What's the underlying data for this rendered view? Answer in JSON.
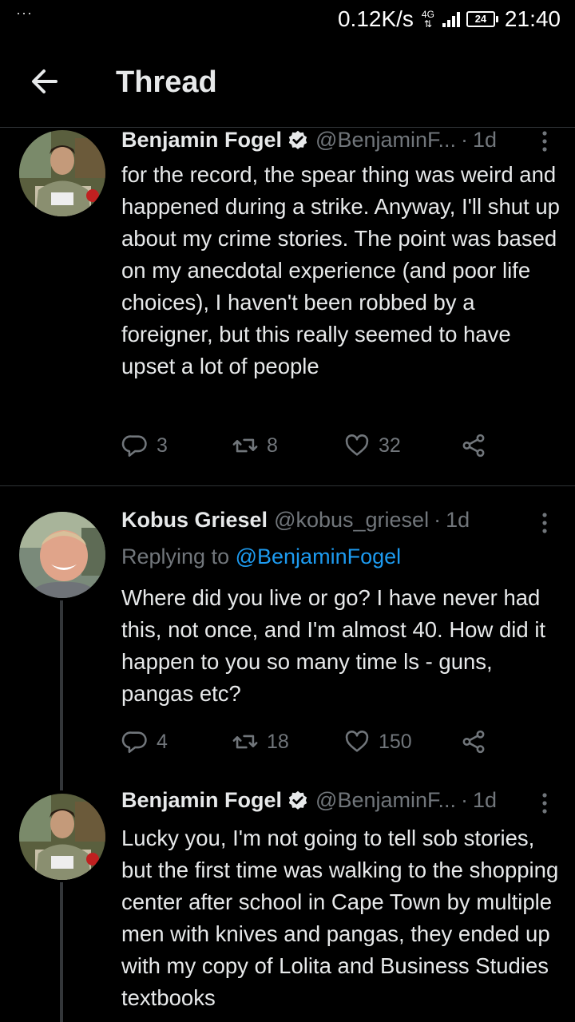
{
  "status_bar": {
    "dots": "···",
    "speed": "0.12K/s",
    "network": "4G",
    "battery": "24",
    "time": "21:40"
  },
  "header": {
    "title": "Thread"
  },
  "tweets": [
    {
      "name": "Benjamin Fogel",
      "handle": "@BenjaminF...",
      "sep": "·",
      "time": "1d",
      "text": "for the record, the spear thing was weird and happened during a strike. Anyway, I'll shut up about my crime stories. The point was based on my anecdotal experience (and poor life choices), I haven't been robbed by a foreigner, but this really seemed to have upset a lot of people",
      "replies": "3",
      "retweets": "8",
      "likes": "32"
    },
    {
      "name": "Kobus Griesel",
      "handle": "@kobus_griesel",
      "sep": "·",
      "time": "1d",
      "replying_prefix": "Replying to",
      "replying_to": "@BenjaminFogel",
      "text": "Where did you live or go? I have never had this, not once, and I'm almost 40. How did it happen to you so many time ls - guns, pangas etc?",
      "replies": "4",
      "retweets": "18",
      "likes": "150"
    },
    {
      "name": "Benjamin Fogel",
      "handle": "@BenjaminF...",
      "sep": "·",
      "time": "1d",
      "text": "Lucky you, I'm not going to tell sob stories, but the first time was walking to the shopping center after school in Cape Town by multiple men with knives and pangas, they ended up with my copy of Lolita and Business Studies textbooks"
    }
  ],
  "colors": {
    "background": "#000000",
    "text": "#e7e9ea",
    "muted": "#71767b",
    "accent": "#1d9bf0",
    "divider": "#2f3336"
  },
  "icons": {
    "back": "arrow-left-icon",
    "verified": "verified-badge-icon",
    "more": "more-vertical-icon",
    "reply": "reply-icon",
    "retweet": "retweet-icon",
    "like": "heart-icon",
    "share": "share-icon"
  }
}
